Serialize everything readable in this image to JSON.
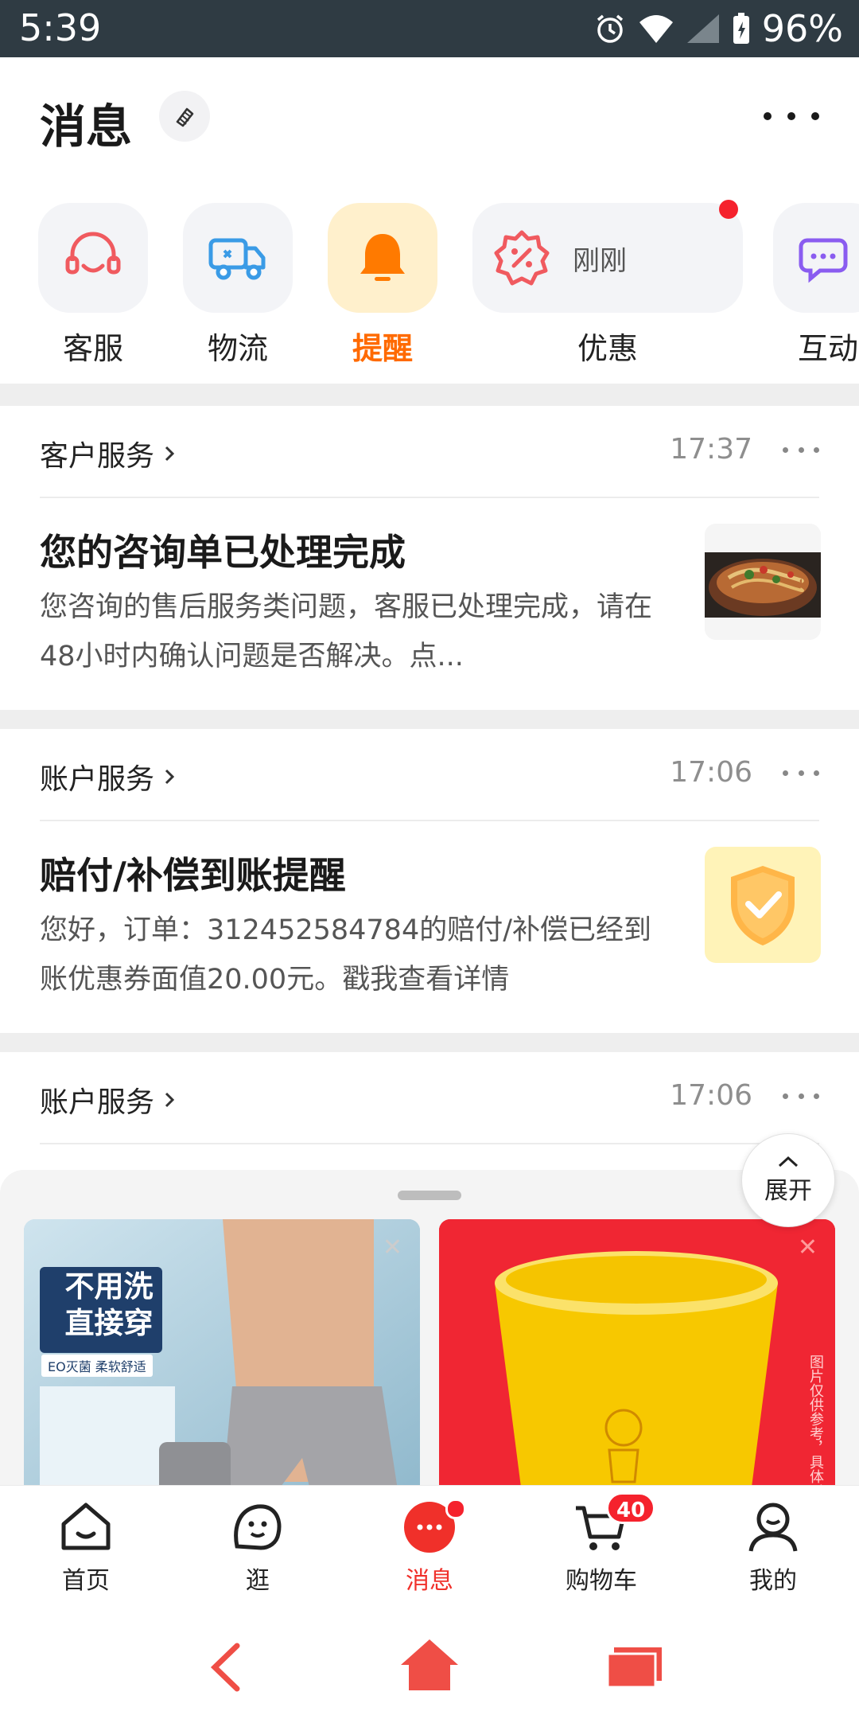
{
  "status_bar": {
    "time": "5:39",
    "battery": "96%"
  },
  "header": {
    "title": "消息"
  },
  "quick_entries": [
    {
      "label": "客服",
      "icon": "headset-icon"
    },
    {
      "label": "物流",
      "icon": "delivery-truck-icon"
    },
    {
      "label": "提醒",
      "icon": "bell-icon",
      "active": true
    },
    {
      "label": "优惠",
      "icon": "coupon-icon",
      "preview": "刚刚",
      "unread": true
    },
    {
      "label": "互动",
      "icon": "chat-bubble-icon"
    }
  ],
  "messages": [
    {
      "category": "客户服务",
      "time": "17:37",
      "title": "您的咨询单已处理完成",
      "body": "您咨询的售后服务类问题，客服已处理完成，请在48小时内确认问题是否解决。点...",
      "thumbnail": "food-dish-image"
    },
    {
      "category": "账户服务",
      "time": "17:06",
      "title": "赔付/补偿到账提醒",
      "body": "您好，订单：312452584784的赔付/补偿已经到账优惠券面值20.00元。戳我查看详情",
      "thumbnail": "shield-check-icon"
    },
    {
      "category": "账户服务",
      "time": "17:06"
    }
  ],
  "sheet": {
    "expand_label": "展开",
    "ads": [
      {
        "text_line1": "不用洗",
        "text_line2": "直接穿",
        "text_line3": "EO灭菌 柔软舒适"
      },
      {
        "side_text": "图片仅供参考，具体以"
      }
    ]
  },
  "tabbar": {
    "items": [
      {
        "label": "首页",
        "icon": "home-icon"
      },
      {
        "label": "逛",
        "icon": "mascot-icon"
      },
      {
        "label": "消息",
        "icon": "message-icon",
        "active": true
      },
      {
        "label": "购物车",
        "icon": "cart-icon",
        "badge": "40"
      },
      {
        "label": "我的",
        "icon": "profile-icon"
      }
    ]
  },
  "colors": {
    "accent": "#f0302a",
    "active_orange": "#ff7a00",
    "status_bar_bg": "#2f3b43"
  }
}
